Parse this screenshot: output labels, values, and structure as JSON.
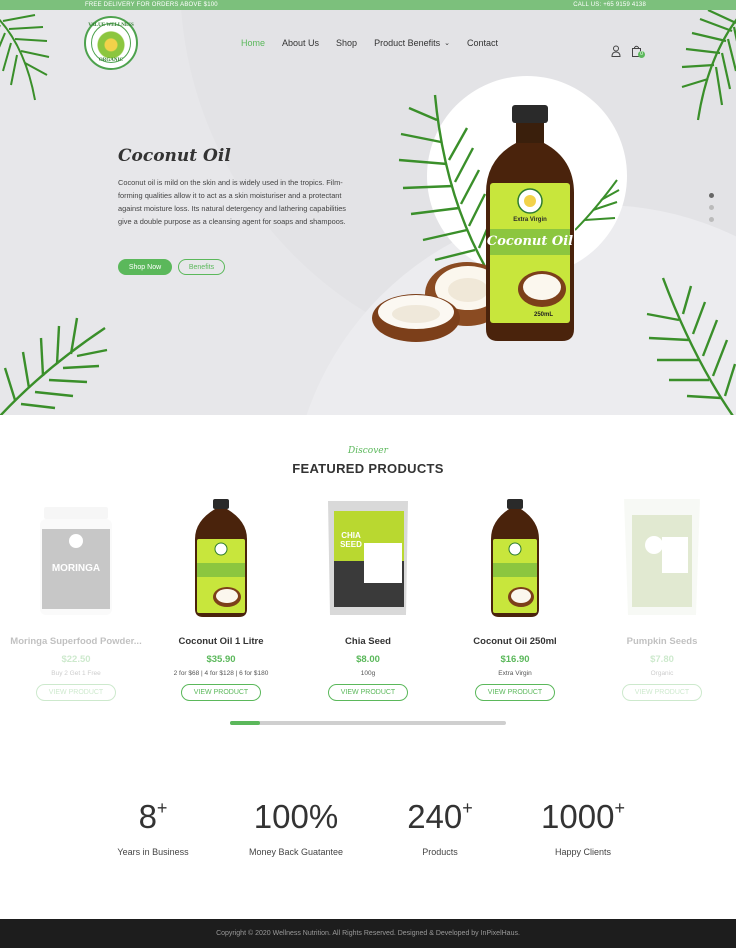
{
  "topbar": {
    "promo": "FREE DELIVERY FOR ORDERS ABOVE $100",
    "phone": "CALL US: +65 9159 4138"
  },
  "brand": {
    "logo_text_top": "VALUE WELLNESS",
    "logo_text_bottom": "ORGANIC",
    "accent_color": "#5bb85b"
  },
  "nav": {
    "items": [
      {
        "label": "Home"
      },
      {
        "label": "About Us"
      },
      {
        "label": "Shop"
      },
      {
        "label": "Product Benefits"
      },
      {
        "label": "Contact"
      }
    ],
    "cart_count": "0",
    "icons": [
      "user-icon",
      "shopping-bag-icon",
      "chevron-down-icon"
    ]
  },
  "hero": {
    "title": "Coconut Oil",
    "description": "Coconut oil is mild on the skin and is widely used in the tropics. Film-forming qualities allow it to act as a skin moisturiser and a protectant against moisture loss. Its natural detergency and lathering capabilities give a double purpose as a cleansing agent for soaps and shampoos.",
    "primary_button": "Shop Now",
    "secondary_button": "Benefits",
    "bottle_label_top": "Extra Virgin",
    "bottle_label_main": "Coconut Oil",
    "bottle_volume": "250mL",
    "slide_indicators": 3,
    "active_slide": 1
  },
  "featured": {
    "eyebrow": "Discover",
    "title": "FEATURED PRODUCTS",
    "products": [
      {
        "name": "Moringa Superfood Powder...",
        "price": "$22.50",
        "note": "Buy 2 Get 1 Free",
        "button": "VIEW PRODUCT",
        "image": "moringa-jar",
        "label": "MORINGA",
        "faded": true
      },
      {
        "name": "Coconut Oil 1 Litre",
        "price": "$35.90",
        "note": "2 for $68 | 4 for $128 | 6 for $180",
        "button": "VIEW PRODUCT",
        "image": "coconut-oil-bottle",
        "faded": false
      },
      {
        "name": "Chia Seed",
        "price": "$8.00",
        "note": "100g",
        "button": "VIEW PRODUCT",
        "image": "chia-seed-pouch",
        "label": "CHIA SEED",
        "faded": false
      },
      {
        "name": "Coconut Oil 250ml",
        "price": "$16.90",
        "note": "Extra Virgin",
        "button": "VIEW PRODUCT",
        "image": "coconut-oil-bottle",
        "faded": false
      },
      {
        "name": "Pumpkin Seeds",
        "price": "$7.80",
        "note": "Organic",
        "button": "VIEW PRODUCT",
        "image": "pumpkin-seed-pouch",
        "faded": true
      }
    ],
    "scroll_progress": 0.11
  },
  "stats": [
    {
      "value": "8",
      "suffix": "+",
      "label": "Years in Business"
    },
    {
      "value": "100%",
      "suffix": "",
      "label": "Money Back Guatantee"
    },
    {
      "value": "240",
      "suffix": "+",
      "label": "Products"
    },
    {
      "value": "1000",
      "suffix": "+",
      "label": "Happy Clients"
    }
  ],
  "footer": {
    "copyright": "Copyright © 2020 Wellness Nutrition. All Rights Reserved. Designed & Developed by InPixelHaus."
  }
}
